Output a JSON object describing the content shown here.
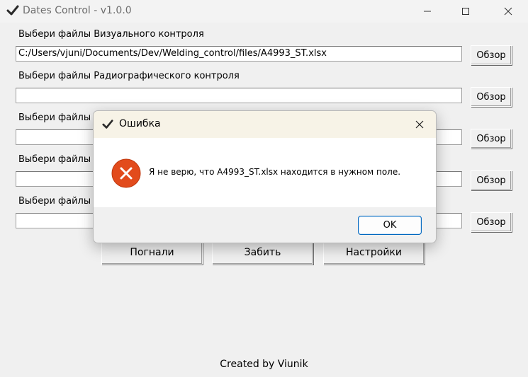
{
  "window": {
    "title": "Dates Control - v1.0.0",
    "icon": "checkmark-icon"
  },
  "sections": [
    {
      "label": "Выбери файлы Визуального контроля",
      "path": "C:/Users/vjuni/Documents/Dev/Welding_control/files/A4993_ST.xlsx",
      "browse_label": "Обзор"
    },
    {
      "label": "Выбери файлы Радиографического контроля",
      "path": "",
      "browse_label": "Обзор"
    },
    {
      "label": "Выбери файлы",
      "path": "",
      "browse_label": "Обзор"
    },
    {
      "label": "Выбери файлы",
      "path": "",
      "browse_label": "Обзор"
    },
    {
      "label": "Выбери файлы",
      "path": "",
      "browse_label": "Обзор"
    }
  ],
  "actions": {
    "go_label": "Погнали",
    "skip_label": "Забить",
    "settings_label": "Настройки"
  },
  "footer": "Created by Viunik",
  "dialog": {
    "title": "Ошибка",
    "icon": "error-icon",
    "message": "Я не верю, что A4993_ST.xlsx находится в нужном поле.",
    "ok_label": "OK"
  },
  "colors": {
    "error_accent": "#e24b1c",
    "button_focus": "#0067c0",
    "dialog_titlebar": "#f7f3e7"
  }
}
